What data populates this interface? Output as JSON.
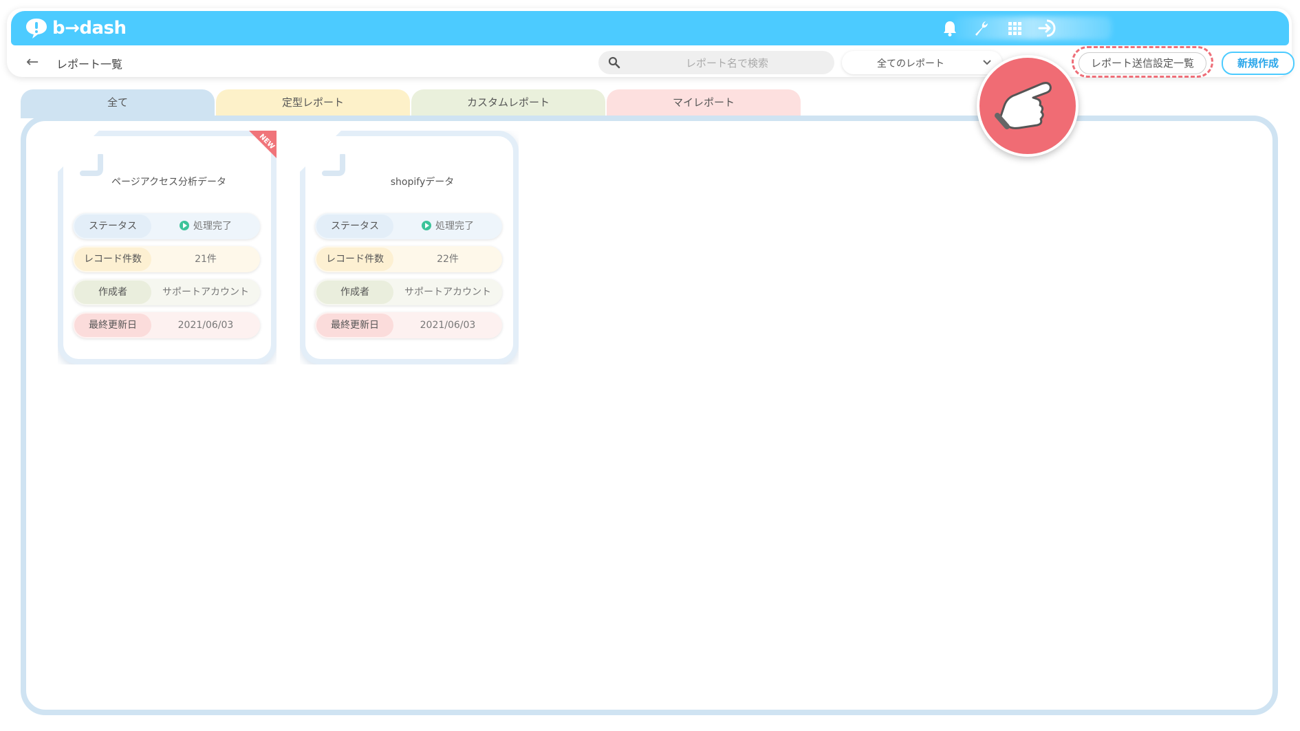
{
  "app": {
    "logo_text": "b→dash"
  },
  "header": {
    "icons": [
      "bell-icon",
      "wrench-icon",
      "grid-icon",
      "logout-icon"
    ]
  },
  "subbar": {
    "title": "レポート一覧",
    "search_placeholder": "レポート名で検索",
    "filter_value": "全てのレポート",
    "send_settings_label": "レポート送信設定一覧",
    "new_button_label": "新規作成"
  },
  "tabs": [
    {
      "label": "全て",
      "color": "#cfe3f2"
    },
    {
      "label": "定型レポート",
      "color": "#fdf1c9"
    },
    {
      "label": "カスタムレポート",
      "color": "#eaf0dc"
    },
    {
      "label": "マイレポート",
      "color": "#fde0df"
    }
  ],
  "cards": [
    {
      "title": "ページアクセス分析データ",
      "badge": "NEW",
      "rows": [
        {
          "label": "ステータス",
          "value": "処理完了"
        },
        {
          "label": "レコード件数",
          "value": "21件"
        },
        {
          "label": "作成者",
          "value": "サポートアカウント"
        },
        {
          "label": "最終更新日",
          "value": "2021/06/03"
        }
      ]
    },
    {
      "title": "shopifyデータ",
      "rows": [
        {
          "label": "ステータス",
          "value": "処理完了"
        },
        {
          "label": "レコード件数",
          "value": "22件"
        },
        {
          "label": "作成者",
          "value": "サポートアカウント"
        },
        {
          "label": "最終更新日",
          "value": "2021/06/03"
        }
      ]
    }
  ],
  "colors": {
    "brand": "#4ccbff",
    "highlight": "#ee6e78",
    "status_ok": "#3cc39a",
    "row_status": "#e3eef8",
    "row_count": "#fdf3dd",
    "row_author": "#eef1e3",
    "row_updated": "#fce6e5"
  }
}
